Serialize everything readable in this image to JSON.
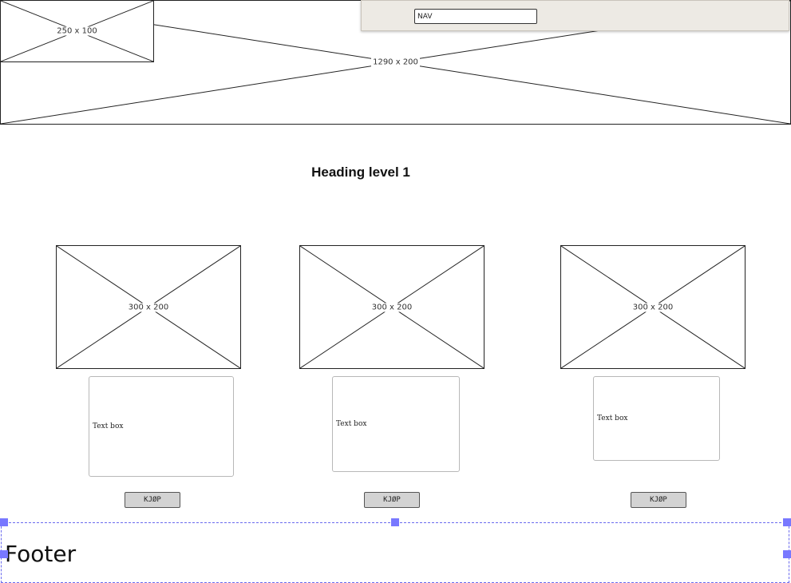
{
  "header": {
    "banner_label": "1290 x 200",
    "logo_label": "250 x 100",
    "nav": {
      "input_value": "NAV"
    }
  },
  "main": {
    "heading": "Heading level 1",
    "products": [
      {
        "image_label": "300 x 200",
        "text": "Text box",
        "button_label": "KJØP"
      },
      {
        "image_label": "300 x 200",
        "text": "Text box",
        "button_label": "KJØP"
      },
      {
        "image_label": "300 x 200",
        "text": "Text box",
        "button_label": "KJØP"
      }
    ]
  },
  "footer": {
    "label": "Footer"
  },
  "colors": {
    "selection": "#7878ff",
    "nav_background": "#edeae4",
    "button_background": "#d3d3d3"
  }
}
